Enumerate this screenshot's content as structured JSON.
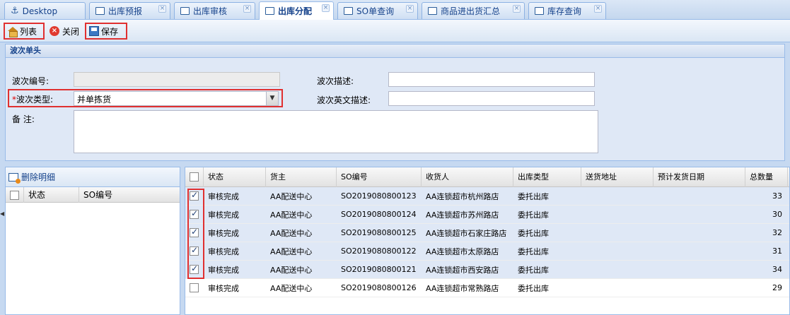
{
  "tabs": [
    {
      "label": "Desktop",
      "icon": "anchor-icon",
      "active": false
    },
    {
      "label": "出库预报",
      "icon": "window-icon",
      "active": false
    },
    {
      "label": "出库审核",
      "icon": "window-icon",
      "active": false
    },
    {
      "label": "出库分配",
      "icon": "window-icon",
      "active": true
    },
    {
      "label": "SO单查询",
      "icon": "window-icon",
      "active": false
    },
    {
      "label": "商品进出货汇总",
      "icon": "window-icon",
      "active": false
    },
    {
      "label": "库存查询",
      "icon": "window-icon",
      "active": false
    }
  ],
  "toolbar": {
    "list_label": "列表",
    "close_label": "关闭",
    "save_label": "保存"
  },
  "panel": {
    "title": "波次单头"
  },
  "form": {
    "wave_no_label": "波次编号:",
    "wave_no_value": "",
    "wave_type_label": "波次类型:",
    "wave_type_value": "并单拣货",
    "wave_desc_label": "波次描述:",
    "wave_desc_value": "",
    "wave_en_desc_label": "波次英文描述:",
    "wave_en_desc_value": "",
    "remark_label": "备 注:",
    "remark_value": "",
    "required_mark": "*"
  },
  "detail": {
    "delete_label": "删除明细",
    "columns": [
      "状态",
      "SO编号"
    ]
  },
  "grid": {
    "columns": [
      "状态",
      "货主",
      "SO编号",
      "收货人",
      "出库类型",
      "送货地址",
      "预计发货日期",
      "总数量"
    ],
    "rows": [
      {
        "checked": true,
        "status": "审核完成",
        "owner": "AA配送中心",
        "so": "SO2019080800123",
        "consignee": "AA连锁超市杭州路店",
        "type": "委托出库",
        "address": "",
        "date": "",
        "qty": "33"
      },
      {
        "checked": true,
        "status": "审核完成",
        "owner": "AA配送中心",
        "so": "SO2019080800124",
        "consignee": "AA连锁超市苏州路店",
        "type": "委托出库",
        "address": "",
        "date": "",
        "qty": "30"
      },
      {
        "checked": true,
        "status": "审核完成",
        "owner": "AA配送中心",
        "so": "SO2019080800125",
        "consignee": "AA连锁超市石家庄路店",
        "type": "委托出库",
        "address": "",
        "date": "",
        "qty": "32"
      },
      {
        "checked": true,
        "status": "审核完成",
        "owner": "AA配送中心",
        "so": "SO2019080800122",
        "consignee": "AA连锁超市太原路店",
        "type": "委托出库",
        "address": "",
        "date": "",
        "qty": "31"
      },
      {
        "checked": true,
        "status": "审核完成",
        "owner": "AA配送中心",
        "so": "SO2019080800121",
        "consignee": "AA连锁超市西安路店",
        "type": "委托出库",
        "address": "",
        "date": "",
        "qty": "34"
      },
      {
        "checked": false,
        "status": "审核完成",
        "owner": "AA配送中心",
        "so": "SO2019080800126",
        "consignee": "AA连锁超市常熟路店",
        "type": "委托出库",
        "address": "",
        "date": "",
        "qty": "29"
      }
    ]
  },
  "colors": {
    "accent": "#15428b",
    "highlight": "#e03030",
    "panel_bg": "#dfe8f6"
  }
}
